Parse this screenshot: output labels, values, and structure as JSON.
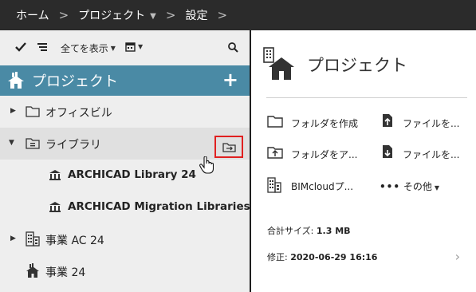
{
  "breadcrumb": {
    "items": [
      "ホーム",
      "プロジェクト",
      "設定"
    ],
    "separator": ">"
  },
  "toolbar": {
    "view_label": "全てを表示"
  },
  "project_header": {
    "title": "プロジェクト"
  },
  "tree": [
    {
      "label": "オフィスビル",
      "icon": "folder-icon"
    },
    {
      "label": "ライブラリ",
      "icon": "library-folder-icon"
    },
    {
      "label": "ARCHICAD Library 24",
      "icon": "library-icon"
    },
    {
      "label": "ARCHICAD Migration Libraries",
      "icon": "library-icon"
    },
    {
      "label": "事業 AC 24",
      "icon": "building-icon"
    },
    {
      "label": "事業 24",
      "icon": "house-icon"
    }
  ],
  "right_panel": {
    "title": "プロジェクト",
    "actions": {
      "create_folder": "フォルダを作成",
      "upload_file": "ファイルを...",
      "upload_folder": "フォルダをア...",
      "download_file": "ファイルを...",
      "bimcloud": "BIMcloudプ...",
      "more": "その他"
    },
    "info": {
      "size_label": "合計サイズ:",
      "size_value": "1.3 MB",
      "modified_label": "修正:",
      "modified_value": "2020-06-29 16:16"
    }
  },
  "colors": {
    "topbar": "#2b2b2b",
    "project_header": "#4a8aa5",
    "highlight_border": "#e02020"
  }
}
